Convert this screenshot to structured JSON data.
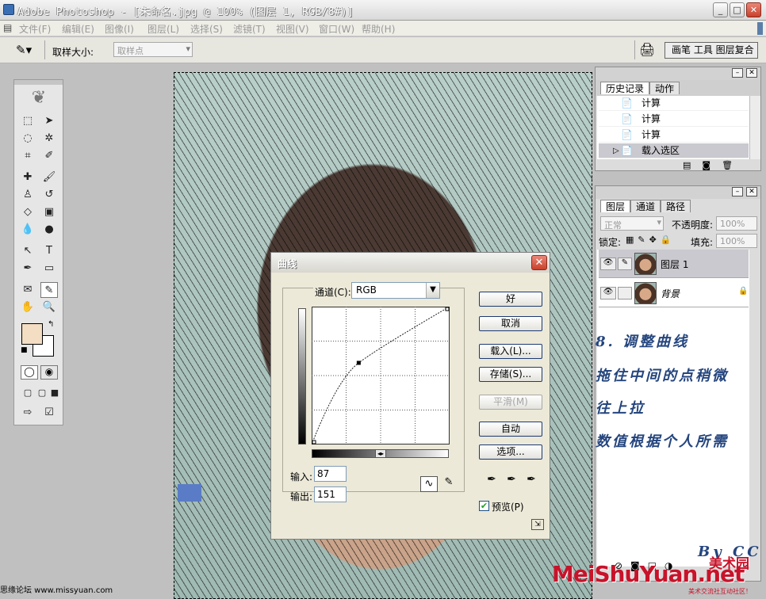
{
  "window": {
    "title": "Adobe Photoshop - [未命名.jpg @ 100% (图层 1, RGB/8#)]"
  },
  "menu": [
    "文件(F)",
    "编辑(E)",
    "图像(I)",
    "图层(L)",
    "选择(S)",
    "滤镜(T)",
    "视图(V)",
    "窗口(W)",
    "帮助(H)"
  ],
  "options": {
    "sample_size_label": "取样大小:",
    "sample_size_value": "取样点"
  },
  "palette_well": {
    "label": "画笔 工具 图层复合"
  },
  "history_panel": {
    "tabs": [
      "历史记录",
      "动作"
    ],
    "items": [
      "计算",
      "计算",
      "计算",
      "载入选区"
    ]
  },
  "layers_panel": {
    "tabs": [
      "图层",
      "通道",
      "路径"
    ],
    "blend_mode": "正常",
    "opacity_label": "不透明度:",
    "opacity_value": "100%",
    "lock_label": "锁定:",
    "fill_label": "填充:",
    "fill_value": "100%",
    "layers": [
      {
        "name": "图层 1",
        "selected": true
      },
      {
        "name": "背景",
        "locked": true
      }
    ]
  },
  "curves_dialog": {
    "title": "曲线",
    "channel_label": "通道(C):",
    "channel_value": "RGB",
    "buttons": [
      "好",
      "取消",
      "载入(L)...",
      "存储(S)...",
      "平滑(M)",
      "自动",
      "选项..."
    ],
    "input_label": "输入:",
    "input_value": "87",
    "output_label": "输出:",
    "output_value": "151",
    "preview_label": "预览(P)",
    "preview_checked": true,
    "curve_point": {
      "input": 87,
      "output": 151
    }
  },
  "annotations": [
    "8. 调整曲线",
    "拖住中间的点稍微",
    "往上拉",
    "数值根据个人所需"
  ],
  "signature": "By CC",
  "footer": {
    "left": "思缘论坛 www.missyuan.com"
  },
  "watermark": {
    "text": "MeiShuYuan.net",
    "cn": "美术园",
    "slogan": "美术交流社互动社区！"
  },
  "colors": {
    "foreground": "#f3dec4",
    "background": "#ffffff",
    "annotation": "#24457e",
    "watermark": "#c8132a"
  }
}
